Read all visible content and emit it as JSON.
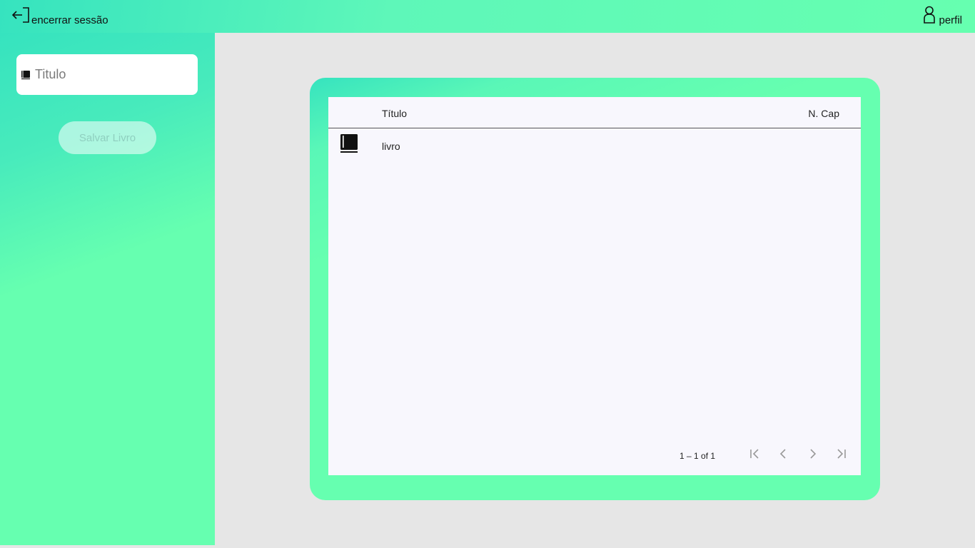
{
  "header": {
    "logout_label": "encerrar sessão",
    "logout_icon": "logout-icon",
    "profile_label": "perfil",
    "profile_icon": "user-icon"
  },
  "sidebar": {
    "title_input": {
      "placeholder": "Titulo",
      "value": "",
      "icon": "book-icon"
    },
    "save_label": "Salvar Livro"
  },
  "table": {
    "columns": [
      "Título",
      "N. Cap"
    ],
    "rows": [
      {
        "icon": "book-icon",
        "title": "livro",
        "chapters": ""
      }
    ],
    "paginator": {
      "range_label": "1 – 1 of 1"
    }
  },
  "colors": {
    "accent_start": "#36e3bf",
    "accent_end": "#66ffb0",
    "page_bg": "#e6e6e6",
    "table_bg": "#f8f7fd"
  }
}
